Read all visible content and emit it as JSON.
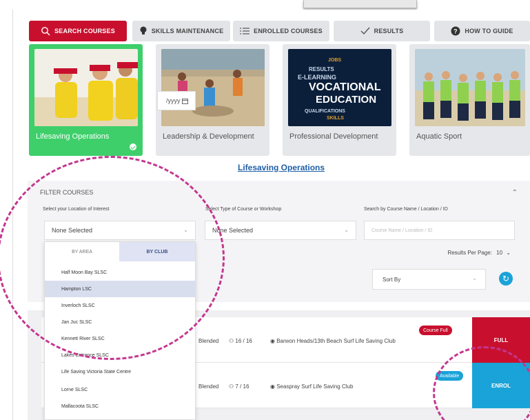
{
  "tabs": [
    {
      "label": "SEARCH COURSES",
      "icon": "search-icon"
    },
    {
      "label": "SKILLS MAINTENANCE",
      "icon": "lightbulb-icon"
    },
    {
      "label": "ENROLLED COURSES",
      "icon": "list-icon"
    },
    {
      "label": "RESULTS",
      "icon": "checkmark-icon"
    },
    {
      "label": "HOW TO GUIDE",
      "icon": "question-icon"
    }
  ],
  "categories": [
    {
      "label": "Lifesaving Operations",
      "selected": true
    },
    {
      "label": "Leadership & Development"
    },
    {
      "label": "Professional Development"
    },
    {
      "label": "Aquatic Sport"
    }
  ],
  "section_title": "Lifesaving Operations",
  "filter": {
    "title": "FILTER COURSES",
    "location_label": "Select your Location of Interest",
    "location_value": "None Selected",
    "type_label": "Select Type of Course or Workshop",
    "type_value": "None Selected",
    "search_label": "Search by Course Name / Location / ID",
    "search_placeholder": "Course Name / Location / ID",
    "results_per_page_label": "Results Per Page:",
    "results_per_page_value": "10",
    "date_value": "/yyyy",
    "sort_by": "Sort By"
  },
  "dropdown": {
    "tab_area": "BY AREA",
    "tab_club": "BY CLUB",
    "items": [
      "Half Moon Bay SLSC",
      "Hampton LSC",
      "Inverloch SLSC",
      "Jan Juc SLSC",
      "Kennett River SLSC",
      "Lakes Entrance SLSC",
      "Life Saving Victoria State Centre",
      "Lorne SLSC",
      "Mallacoota SLSC"
    ],
    "highlighted_index": 1
  },
  "courses": [
    {
      "mode": "Blended",
      "capacity": "16 / 16",
      "location": "Barwon Heads/13th Beach Surf Life Saving Club",
      "badge": "Course Full",
      "action": "FULL"
    },
    {
      "mode": "Blended",
      "capacity": "7 / 16",
      "location": "Seaspray Surf Life Saving Club",
      "badge": "Available",
      "action": "ENROL"
    }
  ],
  "colors": {
    "active_tab": "#c8102e",
    "active_category": "#3ecf6b",
    "full": "#c8102e",
    "enrol": "#1aa3d8",
    "annotation": "#c4368f"
  }
}
